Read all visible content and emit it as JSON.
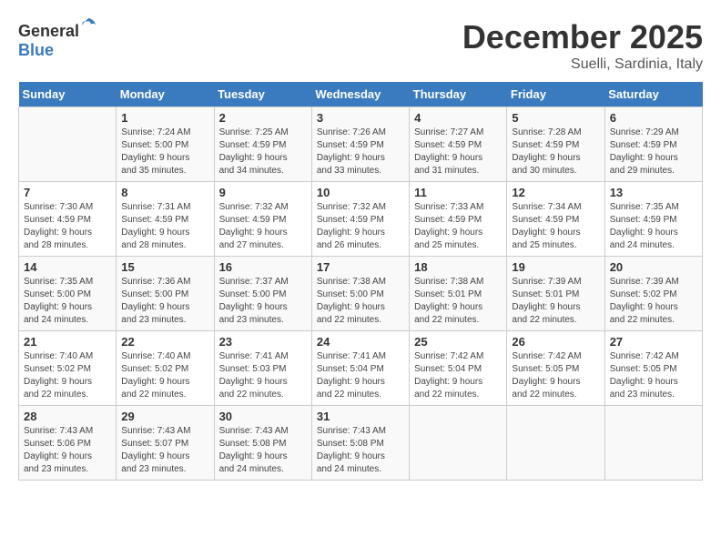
{
  "header": {
    "logo_general": "General",
    "logo_blue": "Blue",
    "month": "December 2025",
    "location": "Suelli, Sardinia, Italy"
  },
  "days_of_week": [
    "Sunday",
    "Monday",
    "Tuesday",
    "Wednesday",
    "Thursday",
    "Friday",
    "Saturday"
  ],
  "weeks": [
    [
      {
        "day": "",
        "info": ""
      },
      {
        "day": "1",
        "info": "Sunrise: 7:24 AM\nSunset: 5:00 PM\nDaylight: 9 hours\nand 35 minutes."
      },
      {
        "day": "2",
        "info": "Sunrise: 7:25 AM\nSunset: 4:59 PM\nDaylight: 9 hours\nand 34 minutes."
      },
      {
        "day": "3",
        "info": "Sunrise: 7:26 AM\nSunset: 4:59 PM\nDaylight: 9 hours\nand 33 minutes."
      },
      {
        "day": "4",
        "info": "Sunrise: 7:27 AM\nSunset: 4:59 PM\nDaylight: 9 hours\nand 31 minutes."
      },
      {
        "day": "5",
        "info": "Sunrise: 7:28 AM\nSunset: 4:59 PM\nDaylight: 9 hours\nand 30 minutes."
      },
      {
        "day": "6",
        "info": "Sunrise: 7:29 AM\nSunset: 4:59 PM\nDaylight: 9 hours\nand 29 minutes."
      }
    ],
    [
      {
        "day": "7",
        "info": "Sunrise: 7:30 AM\nSunset: 4:59 PM\nDaylight: 9 hours\nand 28 minutes."
      },
      {
        "day": "8",
        "info": "Sunrise: 7:31 AM\nSunset: 4:59 PM\nDaylight: 9 hours\nand 28 minutes."
      },
      {
        "day": "9",
        "info": "Sunrise: 7:32 AM\nSunset: 4:59 PM\nDaylight: 9 hours\nand 27 minutes."
      },
      {
        "day": "10",
        "info": "Sunrise: 7:32 AM\nSunset: 4:59 PM\nDaylight: 9 hours\nand 26 minutes."
      },
      {
        "day": "11",
        "info": "Sunrise: 7:33 AM\nSunset: 4:59 PM\nDaylight: 9 hours\nand 25 minutes."
      },
      {
        "day": "12",
        "info": "Sunrise: 7:34 AM\nSunset: 4:59 PM\nDaylight: 9 hours\nand 25 minutes."
      },
      {
        "day": "13",
        "info": "Sunrise: 7:35 AM\nSunset: 4:59 PM\nDaylight: 9 hours\nand 24 minutes."
      }
    ],
    [
      {
        "day": "14",
        "info": "Sunrise: 7:35 AM\nSunset: 5:00 PM\nDaylight: 9 hours\nand 24 minutes."
      },
      {
        "day": "15",
        "info": "Sunrise: 7:36 AM\nSunset: 5:00 PM\nDaylight: 9 hours\nand 23 minutes."
      },
      {
        "day": "16",
        "info": "Sunrise: 7:37 AM\nSunset: 5:00 PM\nDaylight: 9 hours\nand 23 minutes."
      },
      {
        "day": "17",
        "info": "Sunrise: 7:38 AM\nSunset: 5:00 PM\nDaylight: 9 hours\nand 22 minutes."
      },
      {
        "day": "18",
        "info": "Sunrise: 7:38 AM\nSunset: 5:01 PM\nDaylight: 9 hours\nand 22 minutes."
      },
      {
        "day": "19",
        "info": "Sunrise: 7:39 AM\nSunset: 5:01 PM\nDaylight: 9 hours\nand 22 minutes."
      },
      {
        "day": "20",
        "info": "Sunrise: 7:39 AM\nSunset: 5:02 PM\nDaylight: 9 hours\nand 22 minutes."
      }
    ],
    [
      {
        "day": "21",
        "info": "Sunrise: 7:40 AM\nSunset: 5:02 PM\nDaylight: 9 hours\nand 22 minutes."
      },
      {
        "day": "22",
        "info": "Sunrise: 7:40 AM\nSunset: 5:02 PM\nDaylight: 9 hours\nand 22 minutes."
      },
      {
        "day": "23",
        "info": "Sunrise: 7:41 AM\nSunset: 5:03 PM\nDaylight: 9 hours\nand 22 minutes."
      },
      {
        "day": "24",
        "info": "Sunrise: 7:41 AM\nSunset: 5:04 PM\nDaylight: 9 hours\nand 22 minutes."
      },
      {
        "day": "25",
        "info": "Sunrise: 7:42 AM\nSunset: 5:04 PM\nDaylight: 9 hours\nand 22 minutes."
      },
      {
        "day": "26",
        "info": "Sunrise: 7:42 AM\nSunset: 5:05 PM\nDaylight: 9 hours\nand 22 minutes."
      },
      {
        "day": "27",
        "info": "Sunrise: 7:42 AM\nSunset: 5:05 PM\nDaylight: 9 hours\nand 23 minutes."
      }
    ],
    [
      {
        "day": "28",
        "info": "Sunrise: 7:43 AM\nSunset: 5:06 PM\nDaylight: 9 hours\nand 23 minutes."
      },
      {
        "day": "29",
        "info": "Sunrise: 7:43 AM\nSunset: 5:07 PM\nDaylight: 9 hours\nand 23 minutes."
      },
      {
        "day": "30",
        "info": "Sunrise: 7:43 AM\nSunset: 5:08 PM\nDaylight: 9 hours\nand 24 minutes."
      },
      {
        "day": "31",
        "info": "Sunrise: 7:43 AM\nSunset: 5:08 PM\nDaylight: 9 hours\nand 24 minutes."
      },
      {
        "day": "",
        "info": ""
      },
      {
        "day": "",
        "info": ""
      },
      {
        "day": "",
        "info": ""
      }
    ]
  ]
}
